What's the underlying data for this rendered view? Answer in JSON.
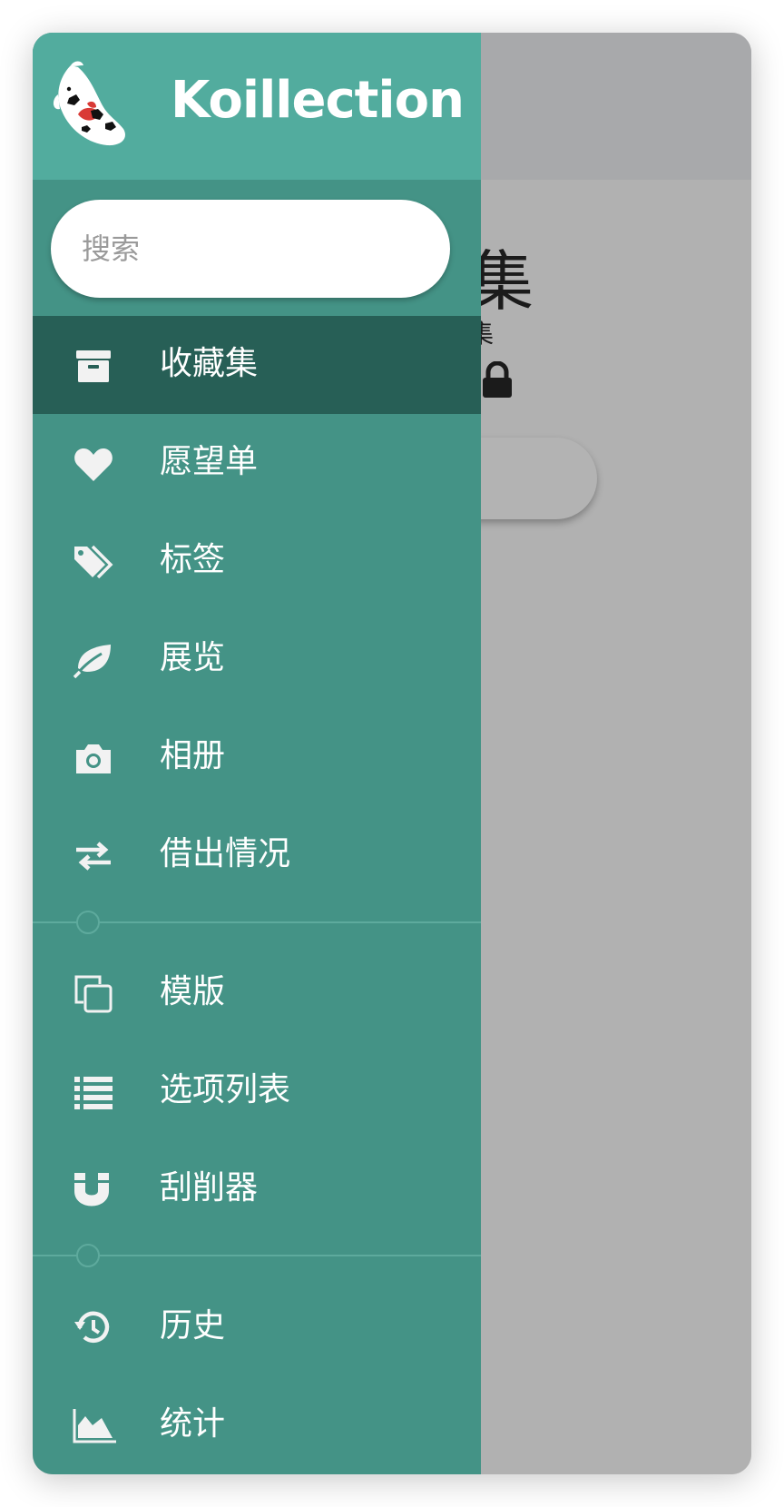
{
  "app": {
    "title": "Koillection"
  },
  "search": {
    "placeholder": "搜索"
  },
  "background_page": {
    "heading_fragment": "集",
    "subtitle_fragment": "集"
  },
  "nav_primary": [
    {
      "label": "收藏集",
      "icon": "archive-box-icon",
      "active": true
    },
    {
      "label": "愿望单",
      "icon": "heart-icon",
      "active": false
    },
    {
      "label": "标签",
      "icon": "tags-icon",
      "active": false
    },
    {
      "label": "展览",
      "icon": "leaf-icon",
      "active": false
    },
    {
      "label": "相册",
      "icon": "camera-icon",
      "active": false
    },
    {
      "label": "借出情况",
      "icon": "exchange-arrows-icon",
      "active": false
    }
  ],
  "nav_secondary": [
    {
      "label": "模版",
      "icon": "copy-icon"
    },
    {
      "label": "选项列表",
      "icon": "list-icon"
    },
    {
      "label": "刮削器",
      "icon": "magnet-icon"
    }
  ],
  "nav_tertiary": [
    {
      "label": "历史",
      "icon": "history-icon"
    },
    {
      "label": "统计",
      "icon": "area-chart-icon"
    }
  ],
  "colors": {
    "header": "#52ac9e",
    "drawer": "#449386",
    "active_item": "#275f56",
    "overlay": "#b1b1b1"
  }
}
